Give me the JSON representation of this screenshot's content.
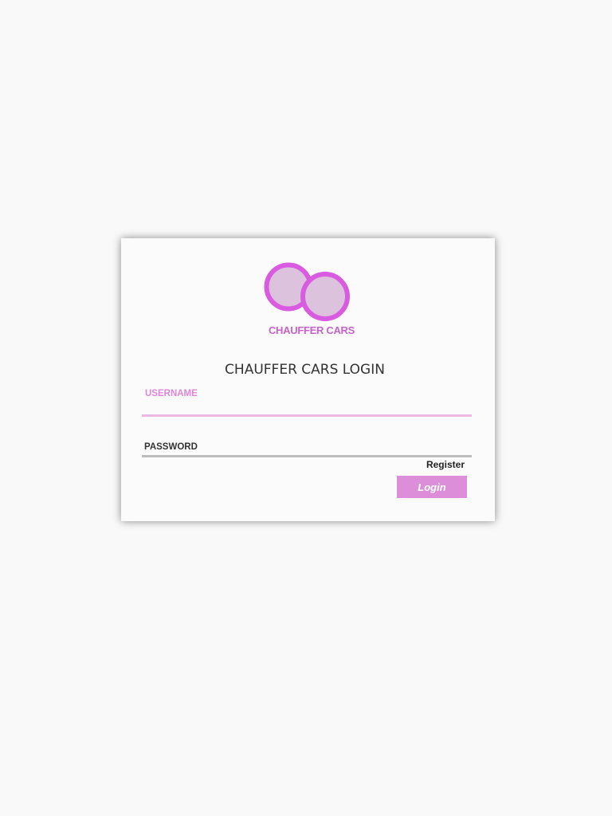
{
  "colors": {
    "page_background": "#f9f9f9",
    "card_background": "#fbfbfb",
    "accent": "#e085d9",
    "logo_ring": "#d95be0",
    "logo_fill": "#dcc2dc",
    "logo_text": "#c662c9",
    "username_underline": "#ecb7e5",
    "password_underline": "#bcbcbc",
    "button_background": "#dc8fd8",
    "text_dark": "#333333"
  },
  "logo": {
    "icon": "two-interlocking-rings-logo-icon",
    "text": "CHAUFFER CARS"
  },
  "login_form": {
    "title": "CHAUFFER CARS LOGIN",
    "username_label": "USERNAME",
    "username_value": "",
    "password_label": "PASSWORD",
    "password_value": "",
    "register_label": "Register",
    "login_button_label": "Login"
  }
}
